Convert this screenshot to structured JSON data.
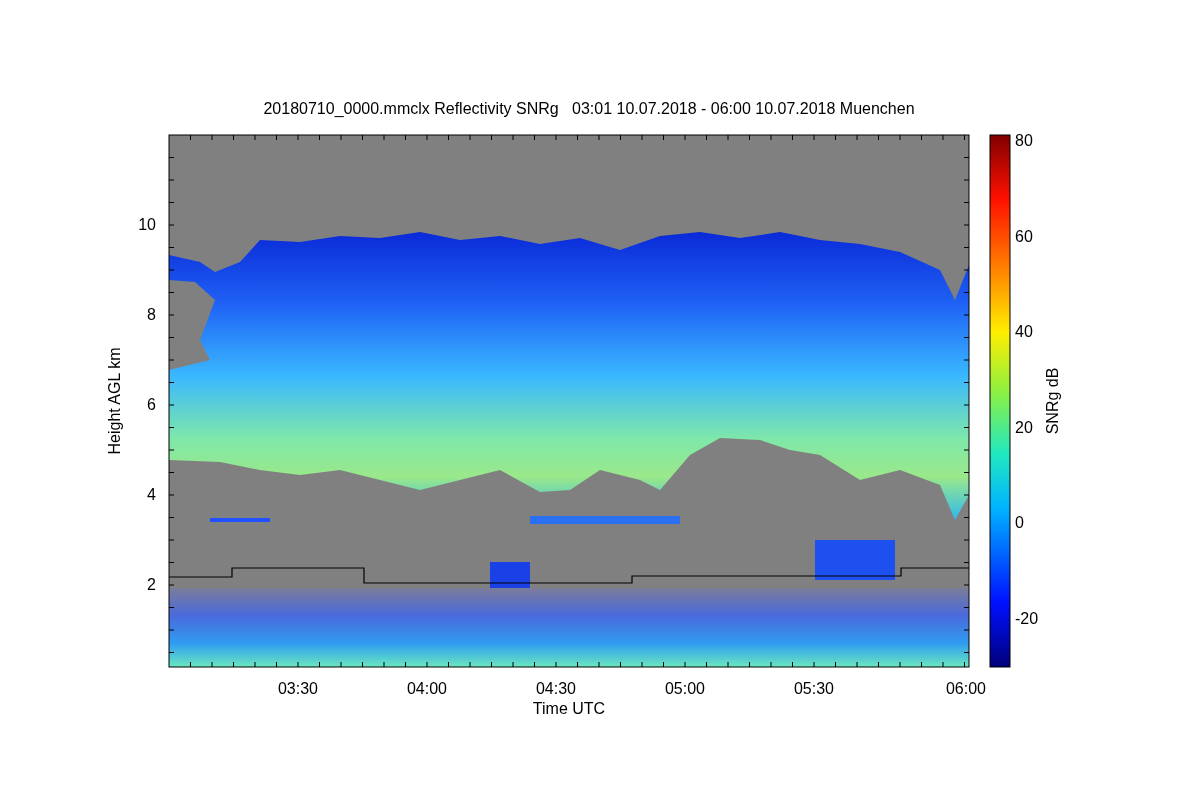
{
  "title": "20180710_0000.mmclx Reflectivity SNRg   03:01 10.07.2018 - 06:00 10.07.2018 Muenchen",
  "y_axis": {
    "label": "Height AGL km",
    "ticks": [
      "10",
      "8",
      "6",
      "4",
      "2"
    ]
  },
  "x_axis": {
    "label": "Time UTC",
    "ticks": [
      "03:30",
      "04:00",
      "04:30",
      "05:00",
      "05:30",
      "06:00"
    ]
  },
  "colorbar": {
    "label": "SNRg dB",
    "ticks": [
      "80",
      "60",
      "40",
      "20",
      "0",
      "-20"
    ]
  }
}
